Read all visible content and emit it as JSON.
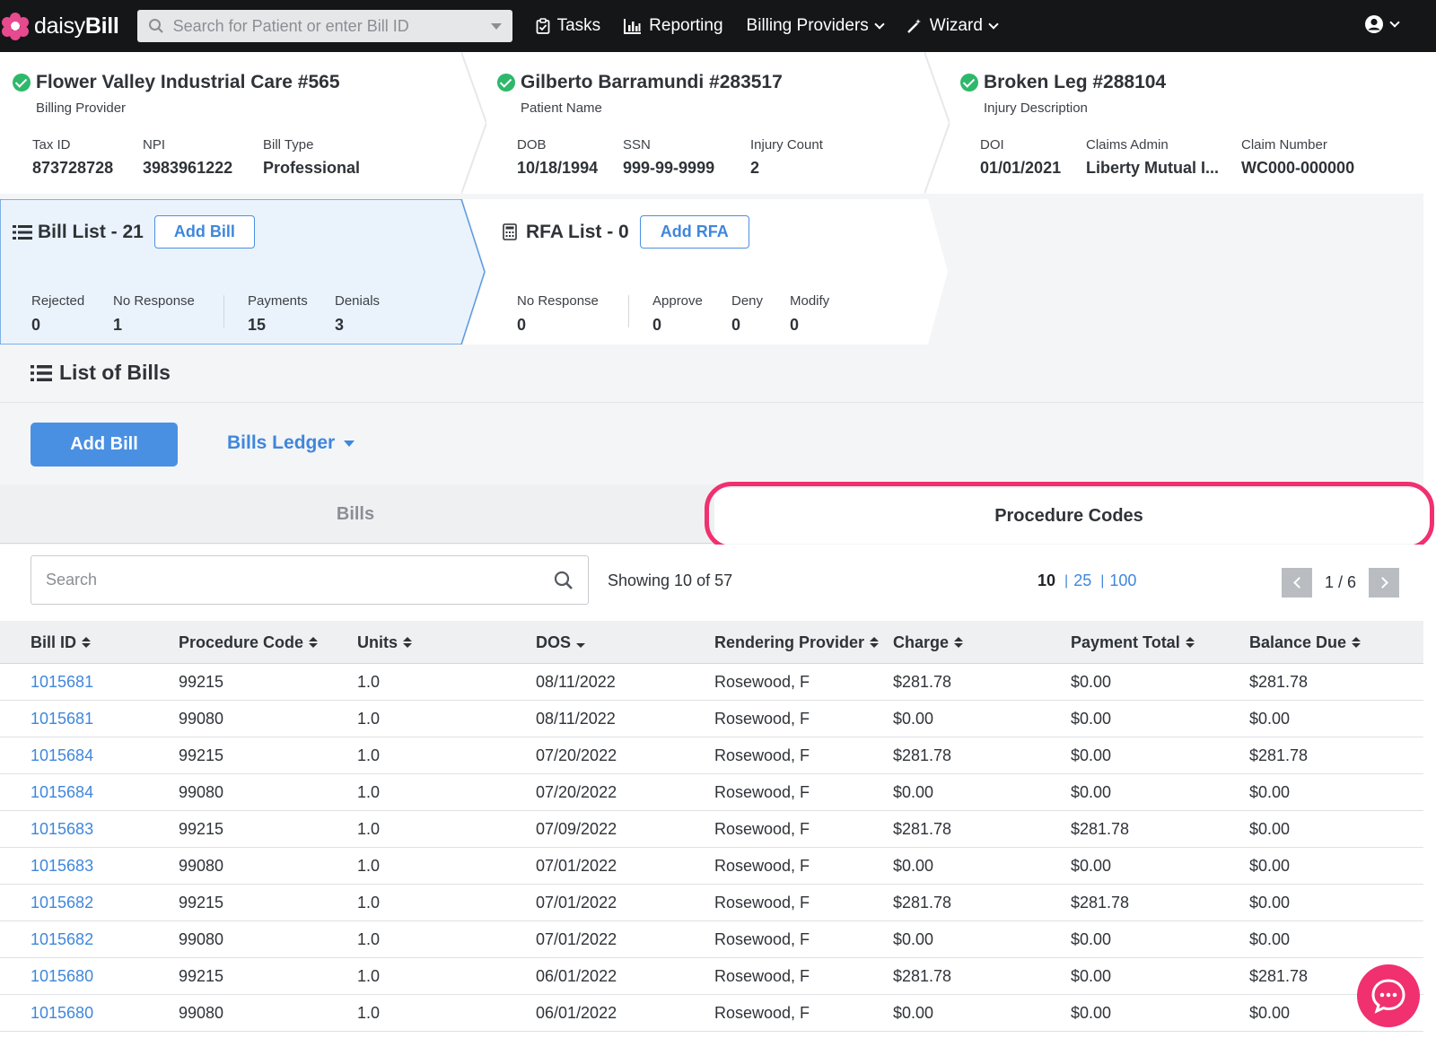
{
  "nav": {
    "logo_plain": "daisy",
    "logo_bold": "Bill",
    "search_placeholder": "Search for Patient or enter Bill ID",
    "items": [
      {
        "label": "Tasks",
        "icon": "clipboard-check-icon"
      },
      {
        "label": "Reporting",
        "icon": "bar-chart-icon"
      },
      {
        "label": "Billing Providers",
        "icon": ""
      },
      {
        "label": "Wizard",
        "icon": "magic-wand-icon"
      }
    ]
  },
  "provider": {
    "title": "Flower Valley Industrial Care #565",
    "subtitle": "Billing Provider",
    "fields": [
      {
        "label": "Tax ID",
        "value": "873728728"
      },
      {
        "label": "NPI",
        "value": "3983961222"
      },
      {
        "label": "Bill Type",
        "value": "Professional"
      }
    ]
  },
  "patient": {
    "title": "Gilberto Barramundi #283517",
    "subtitle": "Patient Name",
    "fields": [
      {
        "label": "DOB",
        "value": "10/18/1994"
      },
      {
        "label": "SSN",
        "value": "999-99-9999"
      },
      {
        "label": "Injury Count",
        "value": "2"
      }
    ]
  },
  "injury": {
    "title": "Broken Leg #288104",
    "subtitle": "Injury Description",
    "fields": [
      {
        "label": "DOI",
        "value": "01/01/2021"
      },
      {
        "label": "Claims Admin",
        "value": "Liberty Mutual I..."
      },
      {
        "label": "Claim Number",
        "value": "WC000-000000"
      }
    ]
  },
  "bill_list": {
    "title": "Bill List - 21",
    "add_label": "Add Bill",
    "stats": [
      {
        "label": "Rejected",
        "value": "0"
      },
      {
        "label": "No Response",
        "value": "1"
      },
      {
        "label": "Payments",
        "value": "15"
      },
      {
        "label": "Denials",
        "value": "3"
      }
    ]
  },
  "rfa_list": {
    "title": "RFA List - 0",
    "add_label": "Add RFA",
    "stats": [
      {
        "label": "No Response",
        "value": "0"
      },
      {
        "label": "Approve",
        "value": "0"
      },
      {
        "label": "Deny",
        "value": "0"
      },
      {
        "label": "Modify",
        "value": "0"
      }
    ]
  },
  "list_of_bills": {
    "title": "List of Bills",
    "add_bill": "Add Bill",
    "ledger": "Bills Ledger"
  },
  "tabs": {
    "bills": "Bills",
    "procedure_codes": "Procedure Codes",
    "active": "procedure_codes"
  },
  "table_controls": {
    "search_placeholder": "Search",
    "showing": "Showing 10 of 57",
    "page_sizes": [
      "10",
      "25",
      "100"
    ],
    "current_size": "10",
    "page": "1 / 6"
  },
  "columns": [
    "Bill ID",
    "Procedure Code",
    "Units",
    "DOS",
    "Rendering Provider",
    "Charge",
    "Payment Total",
    "Balance Due"
  ],
  "rows": [
    [
      "1015681",
      "99215",
      "1.0",
      "08/11/2022",
      "Rosewood, F",
      "$281.78",
      "$0.00",
      "$281.78"
    ],
    [
      "1015681",
      "99080",
      "1.0",
      "08/11/2022",
      "Rosewood, F",
      "$0.00",
      "$0.00",
      "$0.00"
    ],
    [
      "1015684",
      "99215",
      "1.0",
      "07/20/2022",
      "Rosewood, F",
      "$281.78",
      "$0.00",
      "$281.78"
    ],
    [
      "1015684",
      "99080",
      "1.0",
      "07/20/2022",
      "Rosewood, F",
      "$0.00",
      "$0.00",
      "$0.00"
    ],
    [
      "1015683",
      "99215",
      "1.0",
      "07/09/2022",
      "Rosewood, F",
      "$281.78",
      "$281.78",
      "$0.00"
    ],
    [
      "1015683",
      "99080",
      "1.0",
      "07/01/2022",
      "Rosewood, F",
      "$0.00",
      "$0.00",
      "$0.00"
    ],
    [
      "1015682",
      "99215",
      "1.0",
      "07/01/2022",
      "Rosewood, F",
      "$281.78",
      "$281.78",
      "$0.00"
    ],
    [
      "1015682",
      "99080",
      "1.0",
      "07/01/2022",
      "Rosewood, F",
      "$0.00",
      "$0.00",
      "$0.00"
    ],
    [
      "1015680",
      "99215",
      "1.0",
      "06/01/2022",
      "Rosewood, F",
      "$281.78",
      "$0.00",
      "$281.78"
    ],
    [
      "1015680",
      "99080",
      "1.0",
      "06/01/2022",
      "Rosewood, F",
      "$0.00",
      "$0.00",
      "$0.00"
    ]
  ],
  "colors": {
    "accent": "#4a90e2",
    "highlight": "#f0306f",
    "success": "#2eb86b",
    "nav_bg": "#151617"
  }
}
